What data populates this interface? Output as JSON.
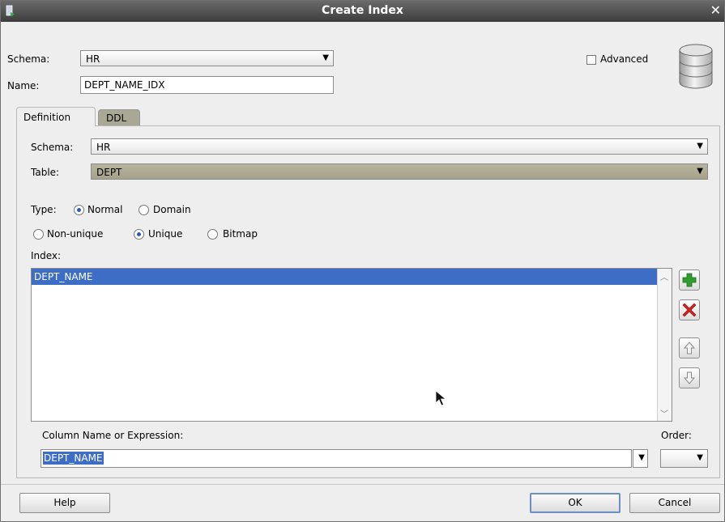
{
  "window": {
    "title": "Create Index"
  },
  "header": {
    "schema_label": "Schema:",
    "schema_value": "HR",
    "name_label": "Name:",
    "name_value": "DEPT_NAME_IDX",
    "advanced_label": "Advanced",
    "advanced_checked": false
  },
  "tabs": [
    {
      "label": "Definition",
      "active": true
    },
    {
      "label": "DDL",
      "active": false
    }
  ],
  "definition": {
    "schema_label": "Schema:",
    "schema_value": "HR",
    "table_label": "Table:",
    "table_value": "DEPT",
    "type_label": "Type:",
    "type_options": [
      {
        "label": "Normal",
        "selected": true
      },
      {
        "label": "Domain",
        "selected": false
      }
    ],
    "uniqueness_options": [
      {
        "label": "Non-unique",
        "selected": false
      },
      {
        "label": "Unique",
        "selected": true
      },
      {
        "label": "Bitmap",
        "selected": false
      }
    ],
    "index_label": "Index:",
    "index_items": [
      "DEPT_NAME"
    ],
    "column_label": "Column Name or Expression:",
    "column_value": "DEPT_NAME",
    "order_label": "Order:",
    "order_value": ""
  },
  "buttons": {
    "help": "Help",
    "ok": "OK",
    "cancel": "Cancel"
  },
  "colors": {
    "selection": "#3d6dc4",
    "table_combo": "#aeaa92",
    "add": "#2f9e2f",
    "remove": "#d42020"
  }
}
